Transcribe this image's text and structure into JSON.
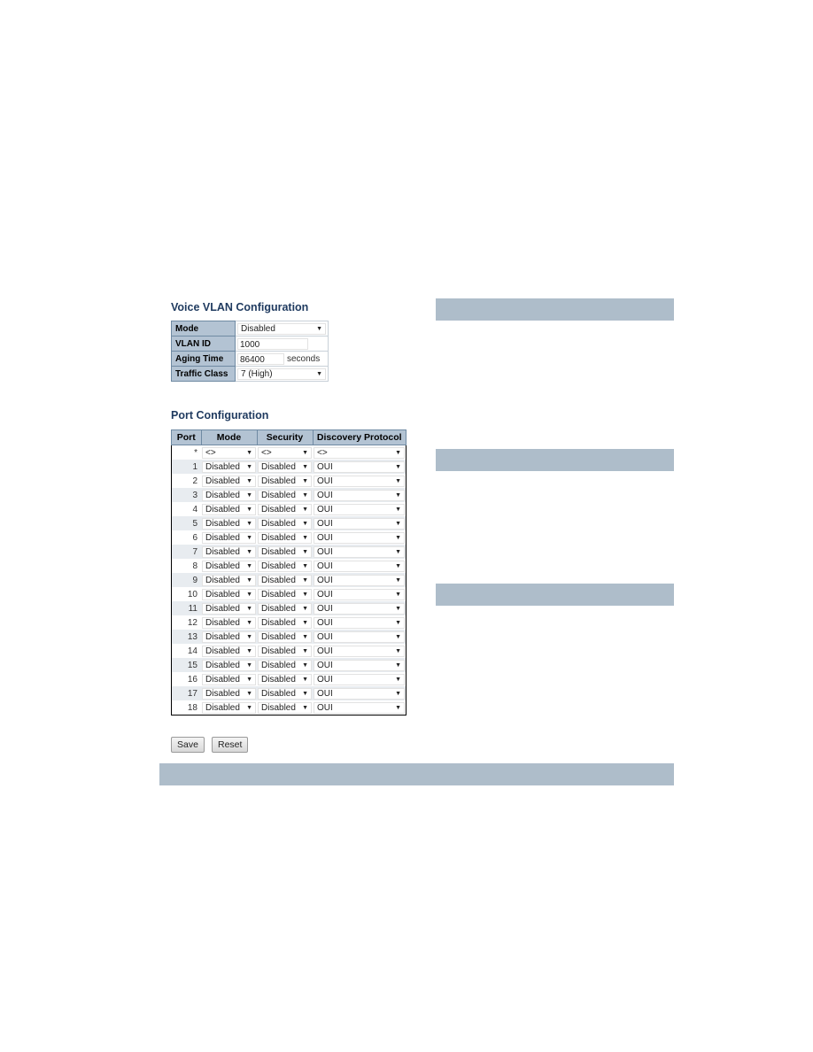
{
  "voice_vlan": {
    "title": "Voice VLAN Configuration",
    "mode_label": "Mode",
    "mode_value": "Disabled",
    "vlan_id_label": "VLAN ID",
    "vlan_id_value": "1000",
    "aging_time_label": "Aging Time",
    "aging_time_value": "86400",
    "aging_time_unit": "seconds",
    "traffic_class_label": "Traffic Class",
    "traffic_class_value": "7 (High)"
  },
  "port_config": {
    "title": "Port Configuration",
    "headers": {
      "port": "Port",
      "mode": "Mode",
      "security": "Security",
      "discovery": "Discovery Protocol"
    },
    "wildcard": {
      "port": "*",
      "mode": "<>",
      "security": "<>",
      "discovery": "<>"
    },
    "rows": [
      {
        "port": "1",
        "mode": "Disabled",
        "security": "Disabled",
        "discovery": "OUI"
      },
      {
        "port": "2",
        "mode": "Disabled",
        "security": "Disabled",
        "discovery": "OUI"
      },
      {
        "port": "3",
        "mode": "Disabled",
        "security": "Disabled",
        "discovery": "OUI"
      },
      {
        "port": "4",
        "mode": "Disabled",
        "security": "Disabled",
        "discovery": "OUI"
      },
      {
        "port": "5",
        "mode": "Disabled",
        "security": "Disabled",
        "discovery": "OUI"
      },
      {
        "port": "6",
        "mode": "Disabled",
        "security": "Disabled",
        "discovery": "OUI"
      },
      {
        "port": "7",
        "mode": "Disabled",
        "security": "Disabled",
        "discovery": "OUI"
      },
      {
        "port": "8",
        "mode": "Disabled",
        "security": "Disabled",
        "discovery": "OUI"
      },
      {
        "port": "9",
        "mode": "Disabled",
        "security": "Disabled",
        "discovery": "OUI"
      },
      {
        "port": "10",
        "mode": "Disabled",
        "security": "Disabled",
        "discovery": "OUI"
      },
      {
        "port": "11",
        "mode": "Disabled",
        "security": "Disabled",
        "discovery": "OUI"
      },
      {
        "port": "12",
        "mode": "Disabled",
        "security": "Disabled",
        "discovery": "OUI"
      },
      {
        "port": "13",
        "mode": "Disabled",
        "security": "Disabled",
        "discovery": "OUI"
      },
      {
        "port": "14",
        "mode": "Disabled",
        "security": "Disabled",
        "discovery": "OUI"
      },
      {
        "port": "15",
        "mode": "Disabled",
        "security": "Disabled",
        "discovery": "OUI"
      },
      {
        "port": "16",
        "mode": "Disabled",
        "security": "Disabled",
        "discovery": "OUI"
      },
      {
        "port": "17",
        "mode": "Disabled",
        "security": "Disabled",
        "discovery": "OUI"
      },
      {
        "port": "18",
        "mode": "Disabled",
        "security": "Disabled",
        "discovery": "OUI"
      }
    ]
  },
  "buttons": {
    "save": "Save",
    "reset": "Reset"
  },
  "icons": {
    "dropdown": "chevron-down-icon"
  },
  "colors": {
    "header_bg": "#b3c3d3",
    "bar_bg": "#aebdca",
    "title": "#1f3a5f",
    "alt_row": "#e8ecf0"
  }
}
